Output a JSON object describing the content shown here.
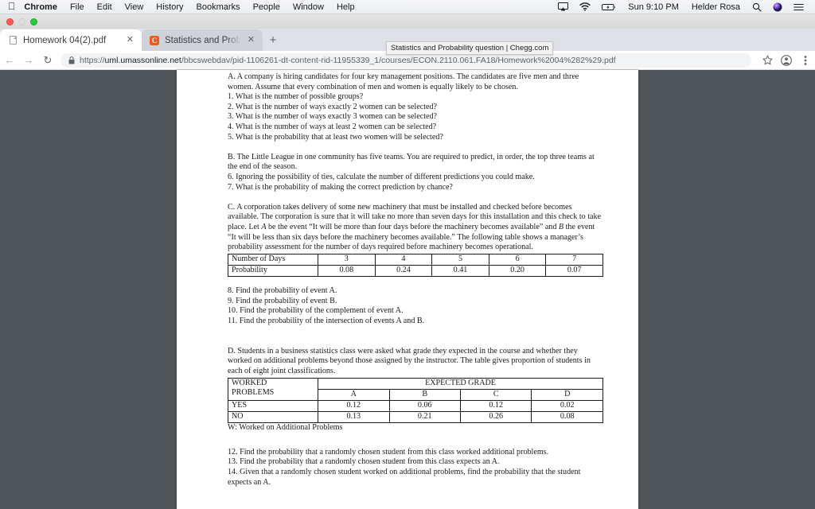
{
  "menubar": {
    "apple_icon": "apple-logo",
    "items": [
      "Chrome",
      "File",
      "Edit",
      "View",
      "History",
      "Bookmarks",
      "People",
      "Window",
      "Help"
    ],
    "status_icons": [
      "airplay-icon",
      "wifi-icon",
      "battery-charging-icon"
    ],
    "clock": "Sun 9:10 PM",
    "user": "Helder Rosa",
    "right_icons": [
      "search-icon",
      "siri-icon",
      "control-center-icon"
    ]
  },
  "browser": {
    "tabs": [
      {
        "title": "Homework 04(2).pdf",
        "favicon": "pdf-file-icon",
        "active": true,
        "close": "✕"
      },
      {
        "title": "Statistics and Probability quest",
        "favicon": "chegg-icon",
        "favicon_letter": "C",
        "active": false,
        "close": "✕"
      }
    ],
    "new_tab_label": "+",
    "tooltip": "Statistics and Probability question | Chegg.com",
    "nav": {
      "back": "←",
      "forward": "→",
      "reload": "↻"
    },
    "omnibox": {
      "lock": "lock-icon",
      "url_scheme": "https://",
      "url_domain": "uml.umassonline.net",
      "url_path": "/bbcswebdav/pid-1106261-dt-content-rid-11955339_1/courses/ECON.2110.061.FA18/Homework%2004%282%29.pdf"
    },
    "toolbar_icons": [
      "bookmark-star-icon",
      "profile-avatar-icon",
      "chrome-menu-icon"
    ]
  },
  "document": {
    "section_a": {
      "intro": "A. A company is hiring candidates for four key management positions. The candidates are five men and three women. Assume that every combination of men and women is equally likely to be chosen.",
      "questions": [
        "1. What is the number of possible groups?",
        "2. What is the number of ways exactly 2 women can be selected?",
        "3. What is the number of ways exactly 3 women can be selected?",
        "4. What is the number of ways at least 2 women can be selected?",
        "5. What is the probability that at least two women will be selected?"
      ]
    },
    "section_b": {
      "intro": "B. The Little League in one community has five teams. You are required to predict, in order, the top three teams at the end of the season.",
      "questions": [
        "6. Ignoring the possibility of ties, calculate the number of different predictions you could make.",
        "7. What is the probability of making the correct prediction by chance?"
      ]
    },
    "section_c": {
      "intro_1": "C. A corporation takes delivery of some new machinery that must be installed and checked before becomes available. The corporation is sure that it will take no more than seven days for this installation and this check to take place. Let ",
      "intro_italic_a": "A",
      "intro_2": " be the event “It will be more than four days before the machinery becomes available” and ",
      "intro_italic_b": "B",
      "intro_3": " the event “It will be less than six days before the machinery becomes available.” The following table shows a manager’s probability assessment for the number of days required before machinery becomes operational.",
      "table": {
        "row_labels": [
          "Number of Days",
          "Probability"
        ],
        "days": [
          "3",
          "4",
          "5",
          "6",
          "7"
        ],
        "probabilities": [
          "0.08",
          "0.24",
          "0.41",
          "0.20",
          "0.07"
        ]
      },
      "questions": [
        "8. Find the probability of event A.",
        "9. Find the probability of event B.",
        "10. Find the probability of the complement of event A.",
        "11. Find the probability of the intersection of events A and B."
      ]
    },
    "section_d": {
      "intro": "D. Students in a business statistics class were asked what grade they expected in the course and whether they worked on additional problems beyond those assigned by the instructor. The table gives proportion of students in each of eight joint classifications.",
      "table": {
        "corner_line1": "WORKED",
        "corner_line2": "PROBLEMS",
        "group_header": "EXPECTED GRADE",
        "grades": [
          "A",
          "B",
          "C",
          "D"
        ],
        "rows": [
          {
            "label": "YES",
            "values": [
              "0.12",
              "0.06",
              "0.12",
              "0.02"
            ]
          },
          {
            "label": "NO",
            "values": [
              "0.13",
              "0.21",
              "0.26",
              "0.08"
            ]
          }
        ]
      },
      "legend": "W: Worked on Additional Problems",
      "questions": [
        "12. Find the probability that a randomly chosen student from this class worked additional problems.",
        "13. Find the probability that a randomly chosen student from this class expects an A.",
        "14. Given that a randomly chosen student worked on additional problems, find the probability that the student expects an A."
      ]
    }
  },
  "colors": {
    "chegg_orange": "#ee5a1e",
    "viewer_background": "#50555a",
    "tabstrip_background": "#dee1e6",
    "page_white": "#ffffff"
  }
}
